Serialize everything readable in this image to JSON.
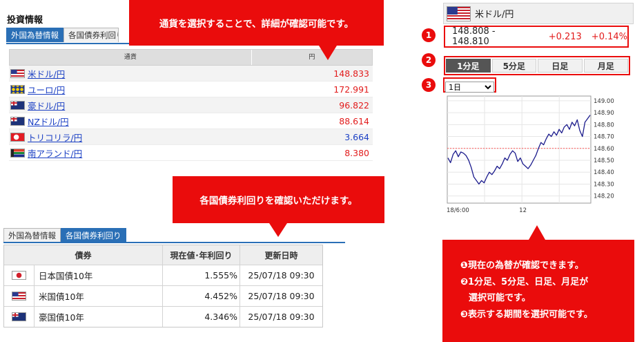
{
  "fx_panel": {
    "title": "投資情報",
    "tabs": [
      {
        "label": "外国為替情報"
      },
      {
        "label": "各国債券利回り"
      }
    ],
    "table_headers": {
      "currency": "通貨",
      "value": "円"
    },
    "rows": [
      {
        "pair": "米ドル/円",
        "value": "148.833",
        "trend": "up",
        "flag": "us-flag-icon"
      },
      {
        "pair": "ユーロ/円",
        "value": "172.991",
        "trend": "up",
        "flag": "eu-flag-icon"
      },
      {
        "pair": "豪ドル/円",
        "value": "96.822",
        "trend": "up",
        "flag": "au-flag-icon"
      },
      {
        "pair": "NZドル/円",
        "value": "88.614",
        "trend": "up",
        "flag": "nz-flag-icon"
      },
      {
        "pair": "トリコリラ/円",
        "value": "3.664",
        "trend": "down",
        "flag": "tr-flag-icon"
      },
      {
        "pair": "南アランド/円",
        "value": "8.380",
        "trend": "up",
        "flag": "za-flag-icon"
      }
    ]
  },
  "callouts": {
    "fx_detail": "通貨を選択することで、詳細が確認可能です。",
    "bond_info": "各国債券利回りを確認いただけます。",
    "widget_lines": [
      "❶現在の為替が確認できます。",
      "❷1分足、5分足、日足、月足が",
      "選択可能です。",
      "❸表示する期間を選択可能です。"
    ]
  },
  "bond_panel": {
    "tabs": [
      {
        "label": "外国為替情報"
      },
      {
        "label": "各国債券利回り"
      }
    ],
    "headers": {
      "bond": "債券",
      "yield": "現在値･年利回り",
      "updated": "更新日時"
    },
    "rows": [
      {
        "name": "日本国債10年",
        "yield": "1.555%",
        "updated": "25/07/18 09:30",
        "flag": "jp-flag-icon"
      },
      {
        "name": "米国債10年",
        "yield": "4.452%",
        "updated": "25/07/18 09:30",
        "flag": "us-flag-icon"
      },
      {
        "name": "豪国債10年",
        "yield": "4.346%",
        "updated": "25/07/18 09:30",
        "flag": "au-flag-icon"
      }
    ]
  },
  "widget": {
    "title": "米ドル/円",
    "bid_ask": "148.808 - 148.810",
    "change": "+0.213",
    "change_pct": "+0.14%",
    "period_tabs": [
      "1分足",
      "5分足",
      "日足",
      "月足"
    ],
    "active_tab": 0,
    "range_select": "1日",
    "markers": [
      "1",
      "2",
      "3"
    ]
  },
  "chart_data": {
    "type": "line",
    "title": "",
    "x_ticks": [
      "18/6:00",
      "12"
    ],
    "y_ticks": [
      "149.00",
      "148.90",
      "148.80",
      "148.70",
      "148.60",
      "148.50",
      "148.40",
      "148.30",
      "148.20"
    ],
    "ylim": [
      148.14,
      149.04
    ],
    "reference_line": 148.6,
    "reference_color": "#ff5555",
    "line_color": "#1a1a8c",
    "grid": true,
    "y": [
      148.52,
      148.48,
      148.55,
      148.58,
      148.53,
      148.57,
      148.56,
      148.54,
      148.5,
      148.44,
      148.36,
      148.33,
      148.3,
      148.33,
      148.31,
      148.36,
      148.4,
      148.38,
      148.41,
      148.45,
      148.43,
      148.47,
      148.52,
      148.5,
      148.55,
      148.58,
      148.56,
      148.49,
      148.52,
      148.47,
      148.45,
      148.43,
      148.46,
      148.5,
      148.54,
      148.6,
      148.65,
      148.63,
      148.68,
      148.72,
      148.7,
      148.74,
      148.71,
      148.76,
      148.73,
      148.78,
      148.8,
      148.76,
      148.82,
      148.79,
      148.84,
      148.75,
      148.7,
      148.82,
      148.85,
      148.88
    ]
  }
}
